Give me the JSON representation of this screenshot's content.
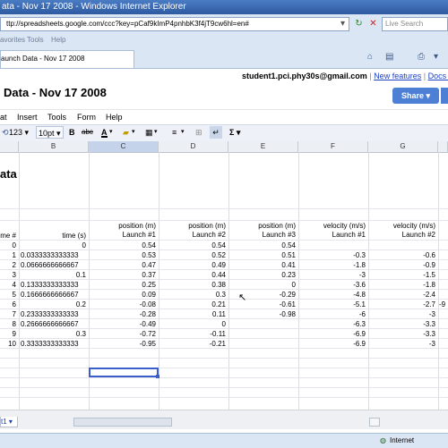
{
  "window": {
    "title": "ata - Nov 17 2008 - Windows Internet Explorer",
    "url": "ttp://spreadsheets.google.com/ccc?key=pCaf9kImP4pnhbK3f4jT9cw6hl=en#",
    "search_placeholder": "Live Search",
    "menu": [
      "avorites",
      "Tools",
      "Help"
    ],
    "tab_label": "aunch Data - Nov 17 2008",
    "status_zone": "Internet"
  },
  "docs": {
    "user_email": "student1.pci.phy30s@gmail.com",
    "separator": "|",
    "new_features": "New features",
    "docs_home": "Docs H",
    "title": "Data - Nov 17 2008",
    "share_label": "Share ▾"
  },
  "app_menu": [
    "at",
    "Insert",
    "Tools",
    "Form",
    "Help"
  ],
  "toolbar": {
    "number_format": "123 ▾",
    "font_size": "10pt ▾",
    "bold": "B",
    "strike": "abc",
    "text_color": "A",
    "sum": "Σ ▾"
  },
  "columns": [
    "B",
    "C",
    "D",
    "E",
    "F",
    "G"
  ],
  "sheet": {
    "big_label": "ata",
    "headers": {
      "a": "me #",
      "b": "time (s)",
      "c1": "position (m)",
      "c2": "Launch #1",
      "d1": "position (m)",
      "d2": "Launch #2",
      "e1": "position (m)",
      "e2": "Launch #3",
      "f1": "velocity (m/s)",
      "f2": "Launch #1",
      "g1": "velocity (m/s)",
      "g2": "Launch #2"
    },
    "rows": [
      {
        "a": "0",
        "b": "0",
        "c": "0.54",
        "d": "0.54",
        "e": "0.54",
        "f": "",
        "g": ""
      },
      {
        "a": "1",
        "b": "0.0333333333333",
        "c": "0.53",
        "d": "0.52",
        "e": "0.51",
        "f": "-0.3",
        "g": "-0.6"
      },
      {
        "a": "2",
        "b": "0.0666666666667",
        "c": "0.47",
        "d": "0.49",
        "e": "0.41",
        "f": "-1.8",
        "g": "-0.9"
      },
      {
        "a": "3",
        "b": "0.1",
        "c": "0.37",
        "d": "0.44",
        "e": "0.23",
        "f": "-3",
        "g": "-1.5"
      },
      {
        "a": "4",
        "b": "0.1333333333333",
        "c": "0.25",
        "d": "0.38",
        "e": "0",
        "f": "-3.6",
        "g": "-1.8"
      },
      {
        "a": "5",
        "b": "0.1666666666667",
        "c": "0.09",
        "d": "0.3",
        "e": "-0.29",
        "f": "-4.8",
        "g": "-2.4"
      },
      {
        "a": "6",
        "b": "0.2",
        "c": "-0.08",
        "d": "0.21",
        "e": "-0.61",
        "f": "-5.1",
        "g": "-2.7"
      },
      {
        "a": "7",
        "b": "0.2333333333333",
        "c": "-0.28",
        "d": "0.11",
        "e": "-0.98",
        "f": "-6",
        "g": "-3"
      },
      {
        "a": "8",
        "b": "0.2666666666667",
        "c": "-0.49",
        "d": "0",
        "e": "",
        "f": "-6.3",
        "g": "-3.3"
      },
      {
        "a": "9",
        "b": "0.3",
        "c": "-0.72",
        "d": "-0.11",
        "e": "",
        "f": "-6.9",
        "g": "-3.3"
      },
      {
        "a": "10",
        "b": "0.3333333333333",
        "c": "-0.95",
        "d": "-0.21",
        "e": "",
        "f": "-6.9",
        "g": "-3"
      }
    ],
    "g_overflow": "-9"
  },
  "sheet_tab": "t1 ▾"
}
